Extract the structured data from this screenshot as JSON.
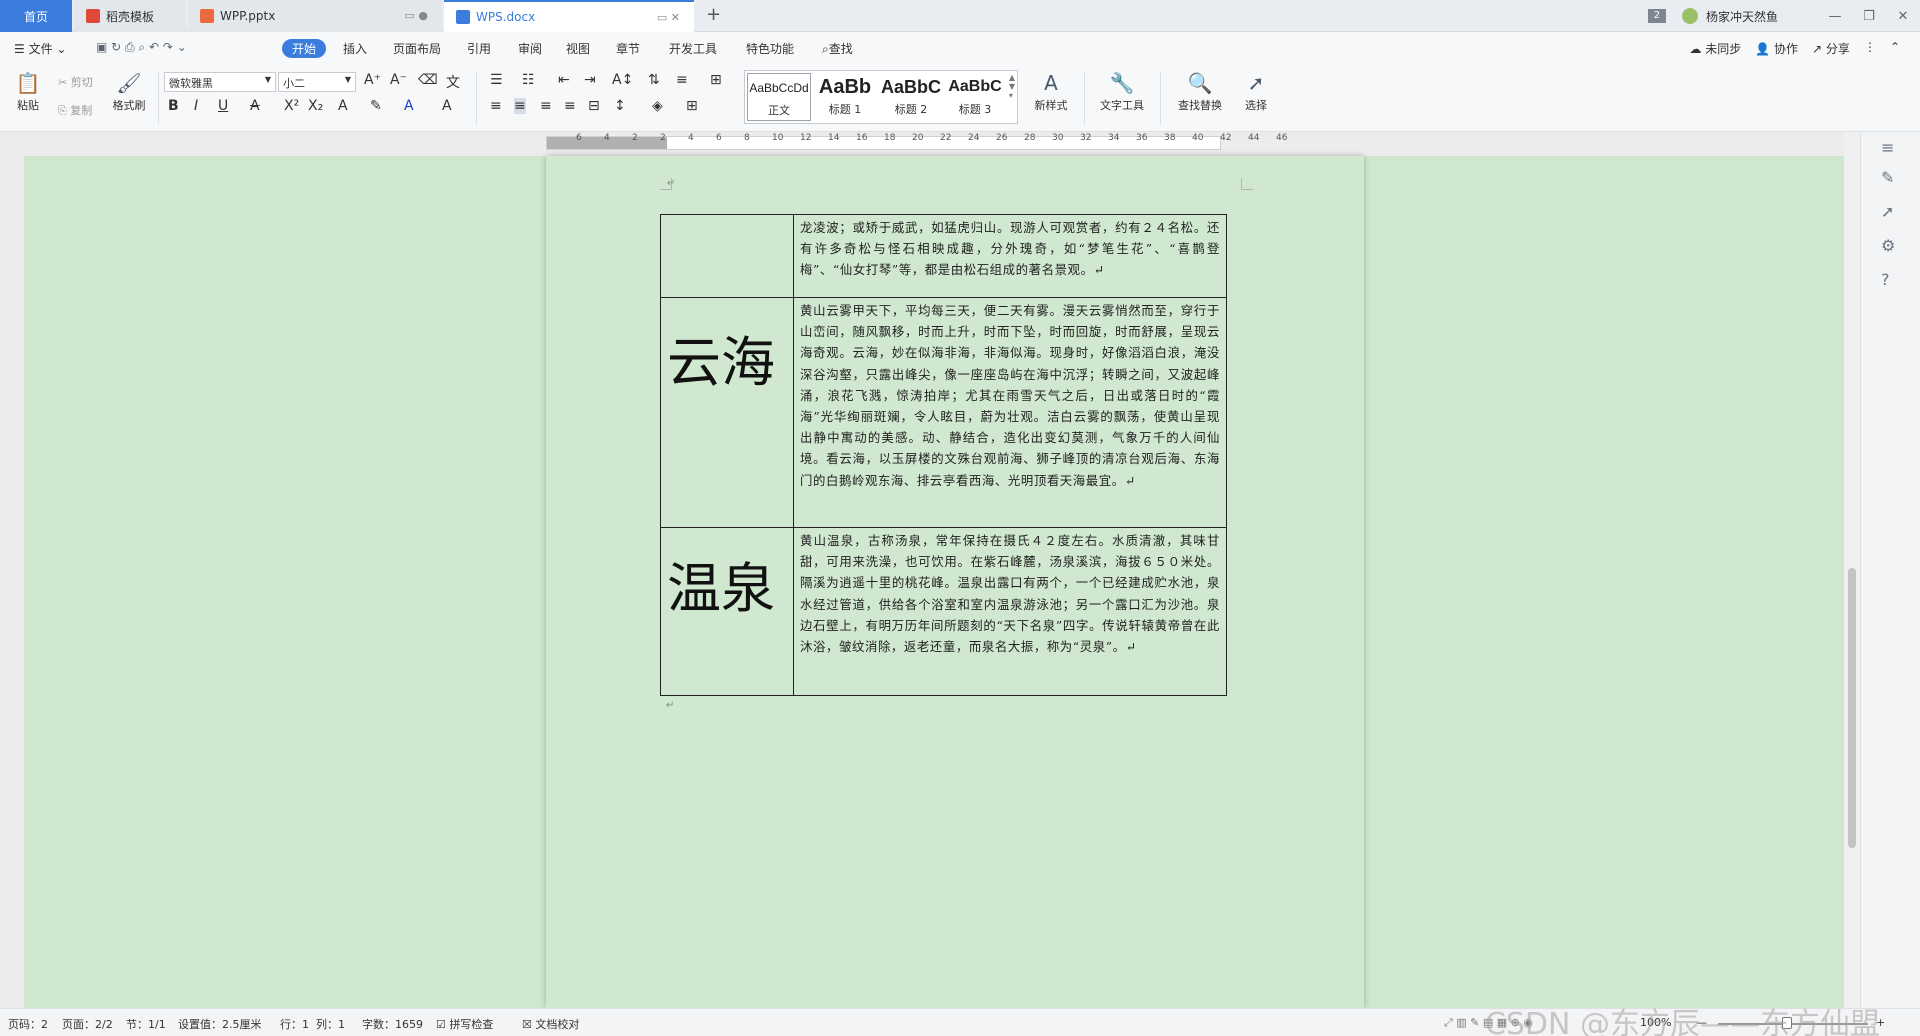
{
  "tabs": {
    "home": "首页",
    "template": "稻壳模板",
    "pptx": "WPP.pptx",
    "docx": "WPS.docx",
    "new_tab": "+"
  },
  "title_right": {
    "badge": "2",
    "user": "杨家冲天然鱼",
    "minimize": "—",
    "restore": "❐",
    "close": "✕"
  },
  "menu": {
    "file": "文件",
    "items": [
      "开始",
      "插入",
      "页面布局",
      "引用",
      "审阅",
      "视图",
      "章节",
      "开发工具",
      "特色功能"
    ],
    "search": "查找",
    "right": [
      "未同步",
      "协作",
      "分享"
    ]
  },
  "ribbon": {
    "paste": "粘贴",
    "cut": "剪切",
    "copy": "复制",
    "format_painter": "格式刷",
    "font_name": "微软雅黑",
    "font_size": "小二",
    "styles": [
      {
        "sample": "AaBbCcDd",
        "name": "正文"
      },
      {
        "sample": "AaBb",
        "name": "标题 1"
      },
      {
        "sample": "AaBbC",
        "name": "标题 2"
      },
      {
        "sample": "AaBbC",
        "name": "标题 3"
      }
    ],
    "new_style": "新样式",
    "text_tools": "文字工具",
    "find_replace": "查找替换",
    "select": "选择"
  },
  "ruler_ticks": [
    "6",
    "4",
    "2",
    "2",
    "4",
    "6",
    "8",
    "10",
    "12",
    "14",
    "16",
    "18",
    "20",
    "22",
    "24",
    "26",
    "28",
    "30",
    "32",
    "34",
    "36",
    "38",
    "40",
    "42",
    "44",
    "46"
  ],
  "document": {
    "rows": [
      {
        "label": "",
        "text": "龙凌波；或矫于威武，如猛虎归山。现游人可观赏者，约有２４名松。还有许多奇松与怪石相映成趣，分外瑰奇，如“梦笔生花”、“喜鹊登梅”、“仙女打琴”等，都是由松石组成的著名景观。"
      },
      {
        "label": "云海",
        "text": "黄山云雾甲天下，平均每三天，便二天有雾。漫天云雾悄然而至，穿行于山峦间，随风飘移，时而上升，时而下坠，时而回旋，时而舒展，呈现云海奇观。云海，妙在似海非海，非海似海。现身时，好像滔滔白浪，淹没深谷沟壑，只露出峰尖，像一座座岛屿在海中沉浮；转瞬之间，又波起峰涌，浪花飞溅，惊涛拍岸；尤其在雨雪天气之后，日出或落日时的“霞海”光华绚丽斑斓，令人眩目，蔚为壮观。洁白云雾的飘荡，使黄山呈现出静中寓动的美感。动、静结合，造化出变幻莫测，气象万千的人间仙境。看云海，以玉屏楼的文殊台观前海、狮子峰顶的清凉台观后海、东海门的白鹅岭观东海、排云亭看西海、光明顶看天海最宜。"
      },
      {
        "label": "温泉",
        "text": "黄山温泉，古称汤泉，常年保持在摄氏４２度左右。水质清澈，其味甘甜，可用来洗澡，也可饮用。在紫石峰麓，汤泉溪滨，海拔６５０米处。隔溪为逍遥十里的桃花峰。温泉出露口有两个，一个已经建成贮水池，泉水经过管道，供给各个浴室和室内温泉游泳池；另一个露口汇为沙池。泉边石壁上，有明万历年间所题刻的“天下名泉”四字。传说轩辕黄帝曾在此沐浴，皱纹消除，返老还童，而泉名大振，称为“灵泉”。"
      }
    ]
  },
  "status": {
    "page_code": "页码：2",
    "pages": "页面：2/2",
    "section": "节：1/1",
    "setting": "设置值：2.5厘米",
    "row": "行：1",
    "col": "列：1",
    "word_count": "字数：1659",
    "spell_check": "拼写检查",
    "doc_proof": "文档校对",
    "zoom": "100%",
    "watermark": "CSDN @东方辰——东方仙盟"
  },
  "colors": {
    "accent": "#3b7ddd",
    "page_bg": "#cfe8cf"
  }
}
